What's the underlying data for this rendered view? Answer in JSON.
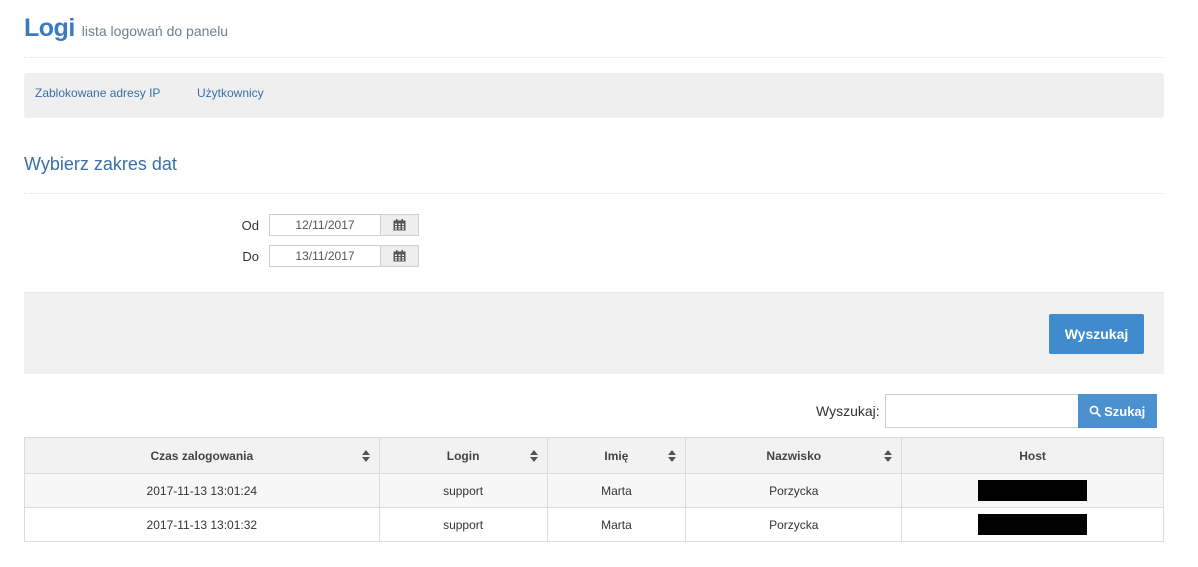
{
  "header": {
    "title": "Logi",
    "subtitle": "lista logowań do panelu"
  },
  "nav": {
    "items": [
      {
        "label": "Zablokowane adresy IP"
      },
      {
        "label": "Użytkownicy"
      }
    ]
  },
  "date_range": {
    "title": "Wybierz zakres dat",
    "from_label": "Od",
    "from_value": "12/11/2017",
    "to_label": "Do",
    "to_value": "13/11/2017",
    "calendar_icon": "calendar-icon"
  },
  "filter": {
    "search_button": "Wyszukaj"
  },
  "table_search": {
    "label": "Wyszukaj:",
    "value": "",
    "button": "Szukaj",
    "button_icon": "search-icon"
  },
  "table": {
    "columns": [
      "Czas zalogowania",
      "Login",
      "Imię",
      "Nazwisko",
      "Host"
    ],
    "sortable": [
      true,
      true,
      true,
      true,
      false
    ],
    "rows": [
      {
        "time": "2017-11-13 13:01:24",
        "login": "support",
        "first_name": "Marta",
        "last_name": "Porzycka",
        "host": "[redacted]"
      },
      {
        "time": "2017-11-13 13:01:32",
        "login": "support",
        "first_name": "Marta",
        "last_name": "Porzycka",
        "host": "[redacted]"
      }
    ]
  },
  "colors": {
    "accent": "#3a7bbf",
    "button": "#3f8bcd",
    "panel_bg": "#efefef"
  }
}
